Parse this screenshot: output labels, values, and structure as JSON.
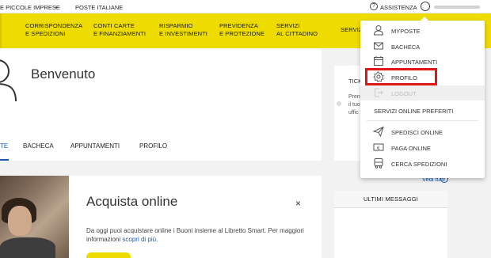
{
  "topbar": {
    "segment_label": "E PICCOLE IMPRESE",
    "brand_link": "POSTE ITALIANE",
    "help_label": "ASSISTENZA"
  },
  "nav": {
    "items": [
      {
        "line1": "CORRISPONDENZA",
        "line2": "E SPEDIZIONI"
      },
      {
        "line1": "CONTI CARTE",
        "line2": "E FINANZIAMENTI"
      },
      {
        "line1": "RISPARMIO",
        "line2": "E INVESTIMENTI"
      },
      {
        "line1": "PREVIDENZA",
        "line2": "E PROTEZIONE"
      },
      {
        "line1": "SERVIZI",
        "line2": "AL CITTADINO"
      },
      {
        "line1": "SERVIZ",
        "line2": ""
      }
    ]
  },
  "main": {
    "welcome": "Benvenuto",
    "tabs": [
      {
        "label": "TE"
      },
      {
        "label": "BACHECA"
      },
      {
        "label": "APPUNTAMENTI"
      },
      {
        "label": "PROFILO"
      }
    ],
    "promo": {
      "title": "Acquista online",
      "close": "×",
      "text": "Da oggi puoi acquistare online i Buoni insieme al Libretto Smart. Per maggiori informazioni",
      "link": "scopri di più."
    }
  },
  "right": {
    "tick_label": "TICK",
    "tick_lines": [
      "Pren",
      "il tuo",
      "uffic"
    ],
    "vedi_tutti": "Vedi tutti",
    "messages_header": "ULTIMI MESSAGGI"
  },
  "dropdown": {
    "items": [
      {
        "label": "MYPOSTE",
        "icon": "user-icon"
      },
      {
        "label": "BACHECA",
        "icon": "mail-icon"
      },
      {
        "label": "APPUNTAMENTI",
        "icon": "calendar-icon"
      },
      {
        "label": "PROFILO",
        "icon": "gear-icon"
      },
      {
        "label": "LOGOUT",
        "icon": "logout-icon"
      }
    ],
    "section_title": "SERVIZI ONLINE PREFERITI",
    "services": [
      {
        "label": "SPEDISCI ONLINE",
        "icon": "paper-plane-icon"
      },
      {
        "label": "PAGA ONLINE",
        "icon": "euro-bill-icon"
      },
      {
        "label": "CERCA SPEDIZIONI",
        "icon": "truck-icon"
      }
    ]
  },
  "colors": {
    "brand_yellow": "#eedc00",
    "link_blue": "#1a5aa8",
    "highlight_red": "#e01717"
  }
}
